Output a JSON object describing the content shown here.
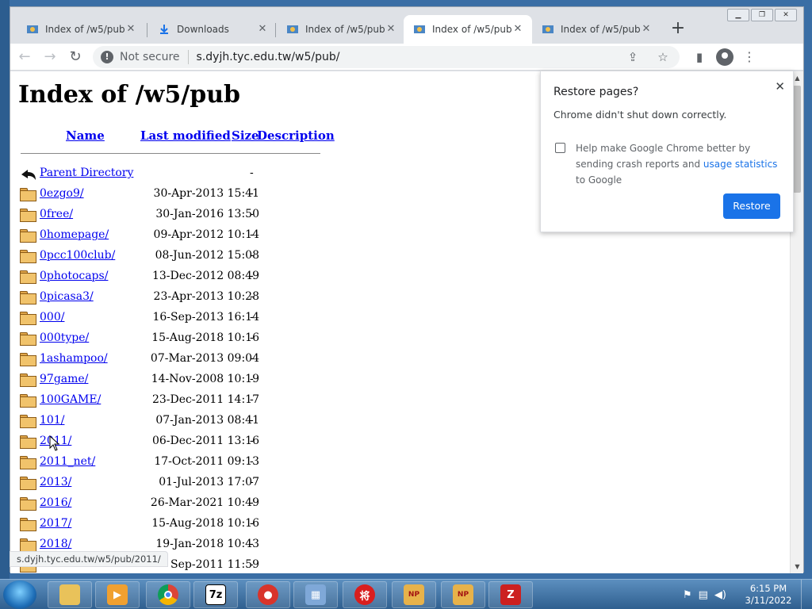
{
  "tabs": [
    {
      "title": "Index of /w5/pub/",
      "icon": "site-favicon"
    },
    {
      "title": "Downloads",
      "icon": "download-icon"
    },
    {
      "title": "Index of /w5/pub",
      "icon": "site-favicon"
    },
    {
      "title": "Index of /w5/pub",
      "icon": "site-favicon",
      "active": true
    },
    {
      "title": "Index of /w5/pub/",
      "icon": "site-favicon"
    }
  ],
  "omnibox": {
    "security": "Not secure",
    "url": "s.dyjh.tyc.edu.tw/w5/pub/"
  },
  "page": {
    "heading": "Index of /w5/pub",
    "columns": {
      "name": "Name",
      "modified": "Last modified",
      "size": "Size",
      "description": "Description"
    },
    "parent": {
      "name": "Parent Directory",
      "size": "-"
    },
    "entries": [
      {
        "name": "0ezgo9/",
        "date": "30-Apr-2013 15:41",
        "size": "-"
      },
      {
        "name": "0free/",
        "date": "30-Jan-2016 13:50",
        "size": "-"
      },
      {
        "name": "0homepage/",
        "date": "09-Apr-2012 10:14",
        "size": "-"
      },
      {
        "name": "0pcc100club/",
        "date": "08-Jun-2012 15:08",
        "size": "-"
      },
      {
        "name": "0photocaps/",
        "date": "13-Dec-2012 08:49",
        "size": "-"
      },
      {
        "name": "0picasa3/",
        "date": "23-Apr-2013 10:28",
        "size": "-"
      },
      {
        "name": "000/",
        "date": "16-Sep-2013 16:14",
        "size": "-"
      },
      {
        "name": "000type/",
        "date": "15-Aug-2018 10:16",
        "size": "-"
      },
      {
        "name": "1ashampoo/",
        "date": "07-Mar-2013 09:04",
        "size": "-"
      },
      {
        "name": "97game/",
        "date": "14-Nov-2008 10:19",
        "size": "-"
      },
      {
        "name": "100GAME/",
        "date": "23-Dec-2011 14:17",
        "size": "-"
      },
      {
        "name": "101/",
        "date": "07-Jan-2013 08:41",
        "size": "-"
      },
      {
        "name": "2011/",
        "date": "06-Dec-2011 13:16",
        "size": "-"
      },
      {
        "name": "2011_net/",
        "date": "17-Oct-2011 09:13",
        "size": "-"
      },
      {
        "name": "2013/",
        "date": "01-Jul-2013 17:07",
        "size": "-"
      },
      {
        "name": "2016/",
        "date": "26-Mar-2021 10:49",
        "size": "-"
      },
      {
        "name": "2017/",
        "date": "15-Aug-2018 10:16",
        "size": "-"
      },
      {
        "name": "2018/",
        "date": "19-Jan-2018 10:43",
        "size": "-"
      },
      {
        "name": "",
        "date": "Sep-2011 11:59",
        "size": "-"
      }
    ]
  },
  "popup": {
    "title": "Restore pages?",
    "message": "Chrome didn't shut down correctly.",
    "checkbox_text_1": "Help make Google Chrome better by sending crash reports and ",
    "checkbox_link": "usage statistics",
    "checkbox_text_2": " to Google",
    "restore_label": "Restore"
  },
  "status_bubble": "s.dyjh.tyc.edu.tw/w5/pub/2011/",
  "clock": {
    "time": "6:15 PM",
    "date": "3/11/2022"
  }
}
